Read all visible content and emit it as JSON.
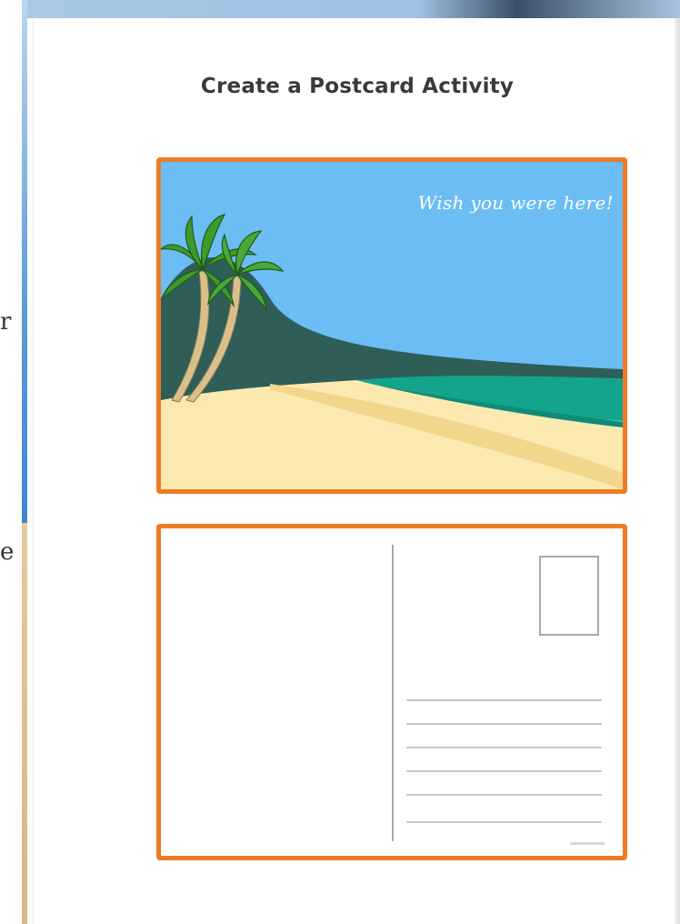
{
  "page": {
    "title": "Create a Postcard Activity"
  },
  "margin_edge": {
    "char_1": "r",
    "char_2": "e"
  },
  "postcard_front": {
    "greeting": "Wish you were here!",
    "scene": "palm-trees-beach-icon",
    "colors": {
      "sky": "#6bbdf3",
      "mountain": "#2f5e58",
      "sea": "#14a48c",
      "sand": "#fbe9b0",
      "sand_dark": "#f1d68c",
      "border": "#ee7a26"
    }
  },
  "postcard_back": {
    "stamp_box": "stamp-box-icon",
    "address_line_count": 6
  }
}
